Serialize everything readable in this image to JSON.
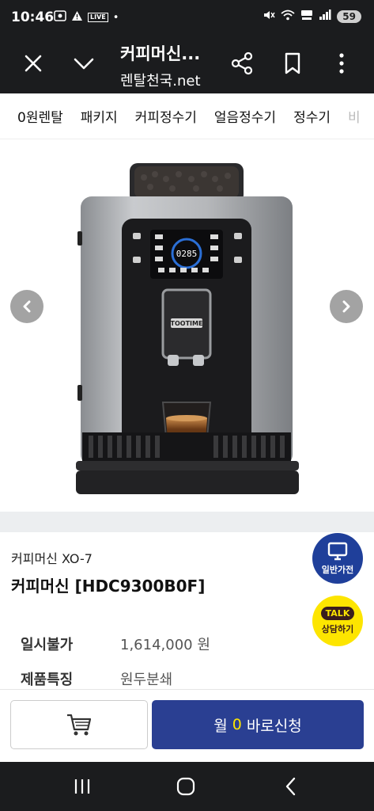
{
  "status_bar": {
    "time": "10:46",
    "live_label": "LIVE",
    "battery": "59"
  },
  "browser": {
    "title": "커피머신...",
    "domain": "렌탈천국.net"
  },
  "nav_tabs": [
    "0원렌탈",
    "패키지",
    "커피정수기",
    "얼음정수기",
    "정수기",
    "비"
  ],
  "product": {
    "subtitle": "커피머신 XO-7",
    "title": "커피머신 [HDC9300B0F]",
    "display_code": "0285",
    "brand_plate": "TOOTIME",
    "specs": [
      {
        "label": "일시불가",
        "value": "1,614,000 원"
      },
      {
        "label": "제품특징",
        "value": "원두분쇄"
      }
    ]
  },
  "float_buttons": {
    "general_label": "일반가전",
    "talk_bubble": "TALK",
    "talk_label": "상담하기"
  },
  "bottom_bar": {
    "apply_prefix": "월",
    "apply_number": "0",
    "apply_suffix": "바로신청"
  },
  "colors": {
    "primary": "#2a3f92",
    "accent_yellow": "#fde500",
    "dark_bar": "#1b1c1e",
    "float_blue": "#1f3f9a"
  },
  "icons": {
    "close": "close-icon",
    "chevron": "chevron-down-icon",
    "share": "share-icon",
    "bookmark": "bookmark-icon",
    "more": "more-vertical-icon",
    "cart": "cart-icon",
    "monitor": "monitor-icon",
    "arrow_left": "arrow-left-icon",
    "arrow_right": "arrow-right-icon"
  }
}
